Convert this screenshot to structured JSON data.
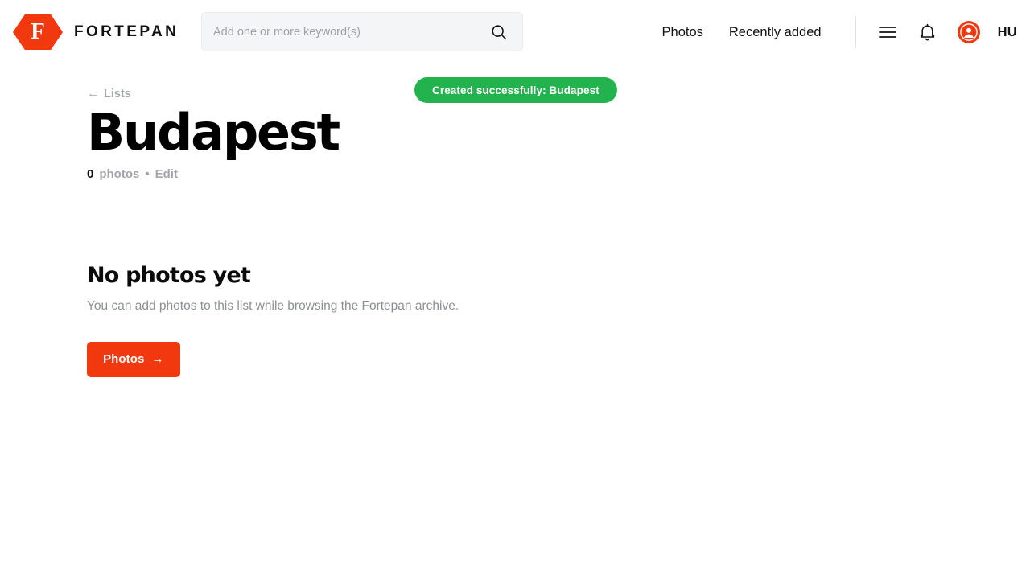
{
  "header": {
    "brand_name": "FORTEPAN",
    "brand_letter": "F",
    "search": {
      "placeholder": "Add one or more keyword(s)",
      "value": ""
    },
    "nav_links": [
      {
        "label": "Photos"
      },
      {
        "label": "Recently added"
      }
    ],
    "icons": {
      "menu": "hamburger-menu-icon",
      "notifications": "bell-icon",
      "avatar": "user-avatar-icon",
      "search": "search-icon"
    },
    "language": "HU"
  },
  "toast": {
    "message": "Created successfully: Budapest",
    "color": "#22B24E"
  },
  "main": {
    "breadcrumb": {
      "arrow": "←",
      "label": "Lists"
    },
    "title": "Budapest",
    "meta": {
      "count": "0",
      "count_label": "photos",
      "separator": "•",
      "edit_label": "Edit"
    },
    "empty_state": {
      "title": "No photos yet",
      "subtitle": "You can add photos to this list while browsing the Fortepan archive.",
      "cta_label": "Photos",
      "cta_arrow": "→"
    }
  },
  "colors": {
    "brand": "#F2380F",
    "success": "#22B24E",
    "muted": "#A3A6AA"
  }
}
